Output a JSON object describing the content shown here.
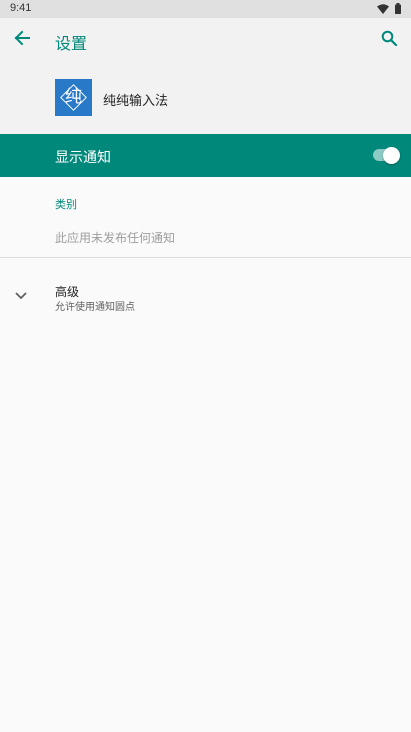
{
  "status_bar": {
    "time": "9:41",
    "icons": [
      "wifi-icon",
      "battery-icon"
    ]
  },
  "app_bar": {
    "title": "设置",
    "back_icon": "back-arrow-icon",
    "search_icon": "search-icon"
  },
  "app_header": {
    "icon_glyph": "纯",
    "app_name": "纯纯输入法"
  },
  "master_toggle": {
    "label": "显示通知",
    "enabled": true
  },
  "categories": {
    "header": "类别",
    "empty_text": "此应用未发布任何通知"
  },
  "advanced": {
    "title": "高级",
    "summary": "允许使用通知圆点",
    "icon": "chevron-down-icon"
  },
  "colors": {
    "accent": "#00897b",
    "app_icon_bg": "#2979c9",
    "background": "#fafafa",
    "header_bg": "#f2f2f2"
  }
}
